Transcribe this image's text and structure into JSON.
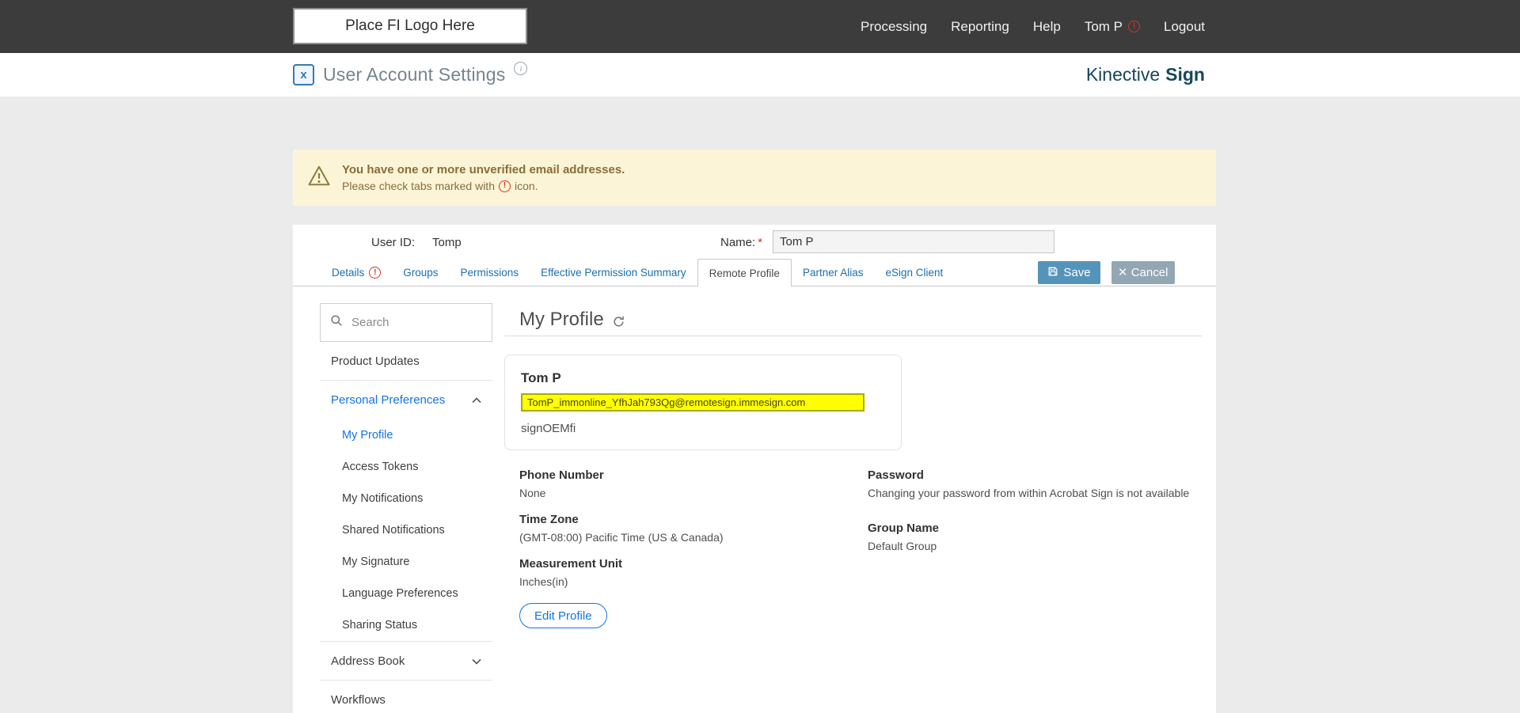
{
  "navbar": {
    "logo_placeholder": "Place FI Logo Here",
    "links": {
      "processing": "Processing",
      "reporting": "Reporting",
      "help": "Help",
      "user": "Tom P",
      "logout": "Logout"
    }
  },
  "header": {
    "title": "User Account Settings",
    "brand_name": "Kinective",
    "brand_suffix": "Sign"
  },
  "banner": {
    "title": "You have one or more unverified email addresses.",
    "subtitle_prefix": "Please check tabs marked with",
    "subtitle_suffix": "icon."
  },
  "panel": {
    "user_id_label": "User ID:",
    "user_id_value": "Tomp",
    "name_label": "Name:",
    "name_required": "*",
    "name_value": "Tom P",
    "tabs": [
      {
        "label": "Details",
        "warning": true
      },
      {
        "label": "Groups"
      },
      {
        "label": "Permissions"
      },
      {
        "label": "Effective Permission Summary"
      },
      {
        "label": "Remote Profile",
        "active": true
      },
      {
        "label": "Partner Alias"
      },
      {
        "label": "eSign Client"
      }
    ],
    "save_label": "Save",
    "cancel_label": "Cancel"
  },
  "sidebar": {
    "search_placeholder": "Search",
    "items": [
      {
        "label": "Product Updates"
      },
      {
        "label": "Personal Preferences",
        "expanded": true,
        "active": true
      },
      {
        "label": "Address Book",
        "expanded": false
      },
      {
        "label": "Workflows"
      }
    ],
    "subitems": [
      {
        "label": "My Profile",
        "active": true
      },
      {
        "label": "Access Tokens"
      },
      {
        "label": "My Notifications"
      },
      {
        "label": "Shared Notifications"
      },
      {
        "label": "My Signature"
      },
      {
        "label": "Language Preferences"
      },
      {
        "label": "Sharing Status"
      }
    ]
  },
  "profile": {
    "heading": "My Profile",
    "name": "Tom P",
    "email": "TomP_immonline_YfhJah793Qg@remotesign.immesign.com",
    "org": "signOEMfi",
    "fields": {
      "phone_label": "Phone Number",
      "phone_value": "None",
      "timezone_label": "Time Zone",
      "timezone_value": "(GMT-08:00) Pacific Time (US & Canada)",
      "unit_label": "Measurement Unit",
      "unit_value": "Inches(in)",
      "password_label": "Password",
      "password_value": "Changing your password from within Acrobat Sign is not available",
      "group_label": "Group Name",
      "group_value": "Default Group"
    },
    "edit_button": "Edit Profile"
  },
  "colors": {
    "accent_blue": "#1473e6",
    "tab_link_blue": "#1a6fae",
    "save_button": "#5494ba",
    "cancel_button": "#92a7b3",
    "highlight_yellow": "#ffff00",
    "banner_bg": "#fbf4d6",
    "banner_text": "#8a6d3b",
    "warning_red": "#d0342c",
    "brand_navy": "#17475a",
    "navbar_bg": "#3c3c3c"
  }
}
